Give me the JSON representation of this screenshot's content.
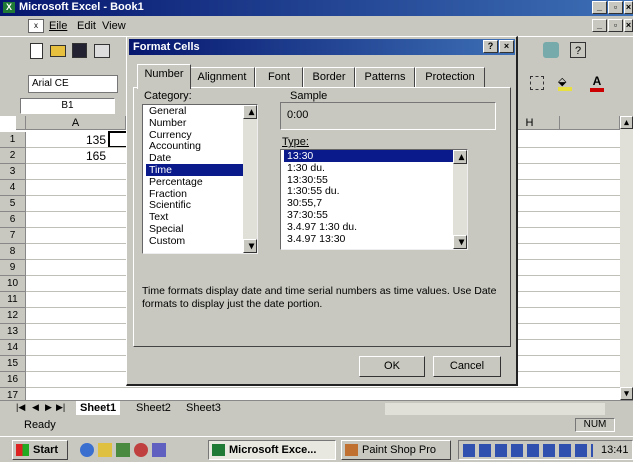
{
  "excel": {
    "title": "Microsoft Excel - Book1",
    "menu": [
      "Eile",
      "Edit",
      "View"
    ],
    "font_name": "Arial CE",
    "name_box": "B1",
    "columns": [
      "A",
      "H"
    ],
    "rows": [
      "1",
      "2",
      "3",
      "4",
      "5",
      "6",
      "7",
      "8",
      "9",
      "10",
      "11",
      "12",
      "13",
      "14",
      "15",
      "16",
      "17"
    ],
    "cells": [
      {
        "value": "135"
      },
      {
        "value": "165"
      }
    ],
    "sheet_tabs": [
      "Sheet1",
      "Sheet2",
      "Sheet3"
    ],
    "status": "Ready",
    "status_num": "NUM"
  },
  "dialog": {
    "title": "Format Cells",
    "help": "?",
    "tabs": [
      "Number",
      "Alignment",
      "Font",
      "Border",
      "Patterns",
      "Protection"
    ],
    "category_label": "Category:",
    "categories": [
      "General",
      "Number",
      "Currency",
      "Accounting",
      "Date",
      "Time",
      "Percentage",
      "Fraction",
      "Scientific",
      "Text",
      "Special",
      "Custom"
    ],
    "selected_category": "Time",
    "sample_label": "Sample",
    "sample_value": "0:00",
    "type_label": "Type:",
    "types": [
      "13:30",
      "1:30 du.",
      "13:30:55",
      "1:30:55 du.",
      "30:55,7",
      "37:30:55",
      "3.4.97 1:30 du.",
      "3.4.97 13:30"
    ],
    "selected_type": "13:30",
    "description": "Time formats display date and time serial numbers as time values.  Use Date formats to display just the date portion.",
    "ok_label": "OK",
    "cancel_label": "Cancel"
  },
  "taskbar": {
    "start": "Start",
    "tasks": [
      "Microsoft Exce...",
      "Paint Shop Pro"
    ],
    "time": "13:41"
  },
  "colors": {
    "titlebar": "#06166e",
    "selection": "#0a1a8a",
    "face": "#c8c8c0"
  }
}
